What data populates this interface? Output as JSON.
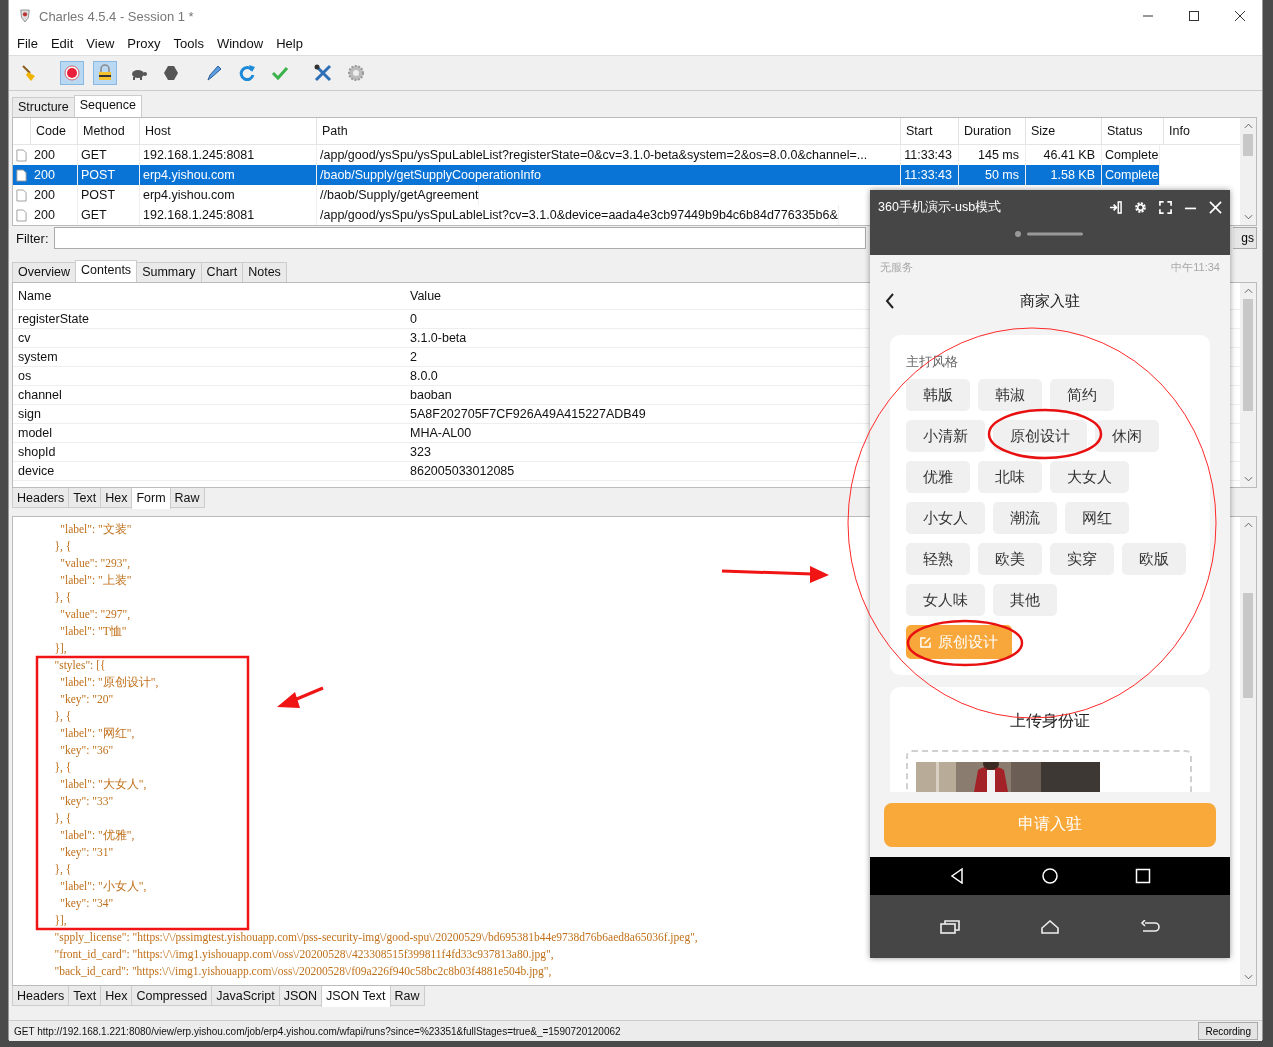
{
  "window": {
    "title": "Charles 4.5.4 - Session 1 *"
  },
  "menu": [
    "File",
    "Edit",
    "View",
    "Proxy",
    "Tools",
    "Window",
    "Help"
  ],
  "toolbar": [
    {
      "kind": "broom",
      "pressed": false
    },
    {
      "kind": "record",
      "pressed": true
    },
    {
      "kind": "lock",
      "pressed": true
    },
    {
      "kind": "turtle",
      "pressed": false
    },
    {
      "kind": "stop",
      "pressed": false
    },
    {
      "kind": "pen",
      "pressed": false
    },
    {
      "kind": "refresh",
      "pressed": false
    },
    {
      "kind": "check",
      "pressed": false
    },
    {
      "kind": "tools",
      "pressed": false
    },
    {
      "kind": "gear",
      "pressed": false
    }
  ],
  "view_tabs": [
    {
      "label": "Structure",
      "selected": false
    },
    {
      "label": "Sequence",
      "selected": true
    }
  ],
  "requests": {
    "columns": [
      "Code",
      "Method",
      "Host",
      "Path",
      "Start",
      "Duration",
      "Size",
      "Status",
      "Info"
    ],
    "rows": [
      {
        "selected": false,
        "cells": [
          "200",
          "GET",
          "192.168.1.245:8081",
          "/app/good/ysSpu/ysSpuLableList?registerState=0&cv=3.1.0-beta&system=2&os=8.0.0&channel=...",
          "11:33:43",
          "145 ms",
          "46.41 KB",
          "Complete"
        ]
      },
      {
        "selected": true,
        "cells": [
          "200",
          "POST",
          "erp4.yishou.com",
          "/baob/Supply/getSupplyCooperationInfo",
          "11:33:43",
          "50 ms",
          "1.58 KB",
          "Complete"
        ]
      },
      {
        "selected": false,
        "cells": [
          "200",
          "POST",
          "erp4.yishou.com",
          "//baob/Supply/getAgreement"
        ]
      },
      {
        "selected": false,
        "cells": [
          "200",
          "GET",
          "192.168.1.245:8081",
          "/app/good/ysSpu/ysSpuLableList?cv=3.1.0&device=aada4e3cb97449b9b4c6b84d776335b6&"
        ]
      }
    ]
  },
  "filter": {
    "label": "Filter:",
    "button": "gs"
  },
  "detail_tabs": [
    {
      "label": "Overview",
      "selected": false
    },
    {
      "label": "Contents",
      "selected": true
    },
    {
      "label": "Summary",
      "selected": false
    },
    {
      "label": "Chart",
      "selected": false
    },
    {
      "label": "Notes",
      "selected": false
    }
  ],
  "form": {
    "columns": [
      "Name",
      "Value"
    ],
    "rows": [
      [
        "registerState",
        "0"
      ],
      [
        "cv",
        "3.1.0-beta"
      ],
      [
        "system",
        "2"
      ],
      [
        "os",
        "8.0.0"
      ],
      [
        "channel",
        "baoban"
      ],
      [
        "sign",
        "5A8F202705F7CF926A49A415227ADB49"
      ],
      [
        "model",
        "MHA-AL00"
      ],
      [
        "shopId",
        "323"
      ],
      [
        "device",
        "862005033012085"
      ]
    ]
  },
  "request_tabs": [
    {
      "label": "Headers",
      "selected": false
    },
    {
      "label": "Text",
      "selected": false
    },
    {
      "label": "Hex",
      "selected": false
    },
    {
      "label": "Form",
      "selected": true
    },
    {
      "label": "Raw",
      "selected": false
    }
  ],
  "response_lines": [
    "      \"label\": \"文装\"",
    "    }, {",
    "      \"value\": \"293\",",
    "      \"label\": \"上装\"",
    "    }, {",
    "      \"value\": \"297\",",
    "      \"label\": \"T恤\"",
    "    }],",
    "    \"styles\": [{",
    "      \"label\": \"原创设计\",",
    "      \"key\": \"20\"",
    "    }, {",
    "      \"label\": \"网红\",",
    "      \"key\": \"36\"",
    "    }, {",
    "      \"label\": \"大女人\",",
    "      \"key\": \"33\"",
    "    }, {",
    "      \"label\": \"优雅\",",
    "      \"key\": \"31\"",
    "    }, {",
    "      \"label\": \"小女人\",",
    "      \"key\": \"34\"",
    "    }],",
    "    \"spply_license\": \"https:\\/\\/pssimgtest.yishouapp.com\\/pss-security-img\\/good-spu\\/20200529\\/bd695381b44e9738d76b6aed8a65036f.jpeg\",",
    "    \"front_id_card\": \"https:\\/\\/img1.yishouapp.com\\/oss\\/20200528\\/423308515f399811f4fd33c937813a80.jpg\",",
    "    \"back_id_card\": \"https:\\/\\/img1.yishouapp.com\\/oss\\/20200528\\/f09a226f940c58bc2c8b03f4881e504b.jpg\","
  ],
  "response_tabs": [
    {
      "label": "Headers",
      "selected": false
    },
    {
      "label": "Text",
      "selected": false
    },
    {
      "label": "Hex",
      "selected": false
    },
    {
      "label": "Compressed",
      "selected": false
    },
    {
      "label": "JavaScript",
      "selected": false
    },
    {
      "label": "JSON",
      "selected": false
    },
    {
      "label": "JSON Text",
      "selected": true
    },
    {
      "label": "Raw",
      "selected": false
    }
  ],
  "status_bar": {
    "text": "GET http://192.168.1.221:8080/view/erp.yishou.com/job/erp4.yishou.com/wfapi/runs?since=%23351&fullStages=true&_=1590720120062",
    "button": "Recording"
  },
  "phone": {
    "title": "360手机演示-usb模式",
    "status_left": "无服务",
    "status_time": "中午11:34",
    "page_title": "商家入驻",
    "section_label": "主打风格",
    "tags": [
      "韩版",
      "韩淑",
      "简约",
      "小清新",
      "原创设计",
      "休闲",
      "优雅",
      "北味",
      "大女人",
      "小女人",
      "潮流",
      "网红",
      "轻熟",
      "欧美",
      "实穿",
      "欧版",
      "女人味",
      "其他"
    ],
    "custom_tag": "原创设计",
    "upload_title": "上传身份证",
    "submit": "申请入驻"
  }
}
